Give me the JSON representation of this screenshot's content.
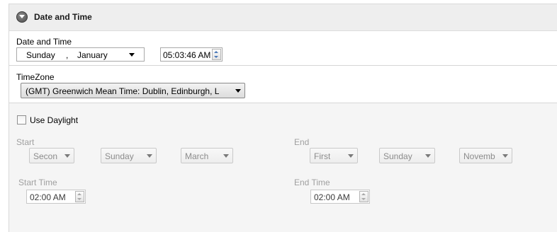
{
  "header": {
    "title": "Date and Time"
  },
  "datetime": {
    "label": "Date and Time",
    "weekday": "Sunday",
    "separator": ",",
    "month": "January",
    "time": "05:03:46 AM"
  },
  "timezone": {
    "label": "TimeZone",
    "selected": "(GMT) Greenwich Mean Time: Dublin, Edinburgh, L"
  },
  "daylight": {
    "checkbox_label": "Use Daylight",
    "checked": false,
    "start": {
      "label": "Start",
      "week": "Secon",
      "day": "Sunday",
      "month": "March",
      "time_label": "Start Time",
      "time": "02:00 AM"
    },
    "end": {
      "label": "End",
      "week": "First",
      "day": "Sunday",
      "month": "Novemb",
      "time_label": "End Time",
      "time": "02:00 AM"
    }
  },
  "colors": {
    "spinner_arrow": "#4a78b8",
    "disabled_text": "#a0a0a0"
  }
}
